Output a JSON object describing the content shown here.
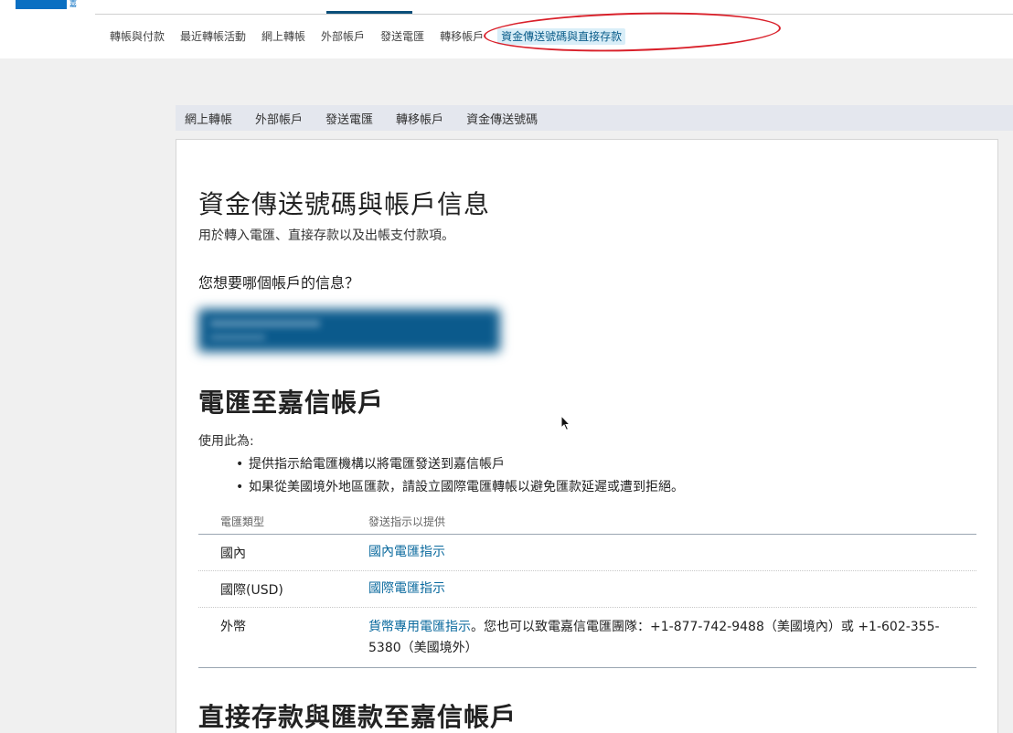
{
  "header": {
    "logo_mark": "嘉"
  },
  "subnav": {
    "items": [
      {
        "label": "轉帳與付款"
      },
      {
        "label": "最近轉帳活動"
      },
      {
        "label": "網上轉帳"
      },
      {
        "label": "外部帳戶"
      },
      {
        "label": "發送電匯"
      },
      {
        "label": "轉移帳戶"
      },
      {
        "label": "資金傳送號碼與直接存款"
      }
    ]
  },
  "inner_tabs": [
    {
      "label": "網上轉帳"
    },
    {
      "label": "外部帳戶"
    },
    {
      "label": "發送電匯"
    },
    {
      "label": "轉移帳戶"
    },
    {
      "label": "資金傳送號碼"
    }
  ],
  "main": {
    "title": "資金傳送號碼與帳戶信息",
    "subtitle": "用於轉入電匯、直接存款以及出帳支付款項。",
    "question": "您想要哪個帳戶的信息？",
    "wire_section": {
      "title": "電匯至嘉信帳戶",
      "use_for": "使用此為:",
      "bullets": [
        "提供指示給電匯機構以將電匯發送到嘉信帳戶",
        "如果從美國境外地區匯款，請設立國際電匯轉帳以避免匯款延遲或遭到拒絕。"
      ],
      "table": {
        "headers": [
          "電匯類型",
          "發送指示以提供"
        ],
        "rows": [
          {
            "type": "國內",
            "link": "國內電匯指示",
            "note": ""
          },
          {
            "type": "國際(USD)",
            "link": "國際電匯指示",
            "note": ""
          },
          {
            "type": "外幣",
            "link": "貨幣專用電匯指示",
            "note": "。您也可以致電嘉信電匯團隊：+1-877-742-9488（美國境內）或 +1-602-355-5380（美國境外）"
          }
        ]
      }
    },
    "deposit_section": {
      "title": "直接存款與匯款至嘉信帳戶"
    }
  },
  "colors": {
    "brand": "#0a6fc2",
    "link": "#0b6a9e",
    "annotation": "#d9202a",
    "active_tab_bg": "#d9eef8"
  }
}
